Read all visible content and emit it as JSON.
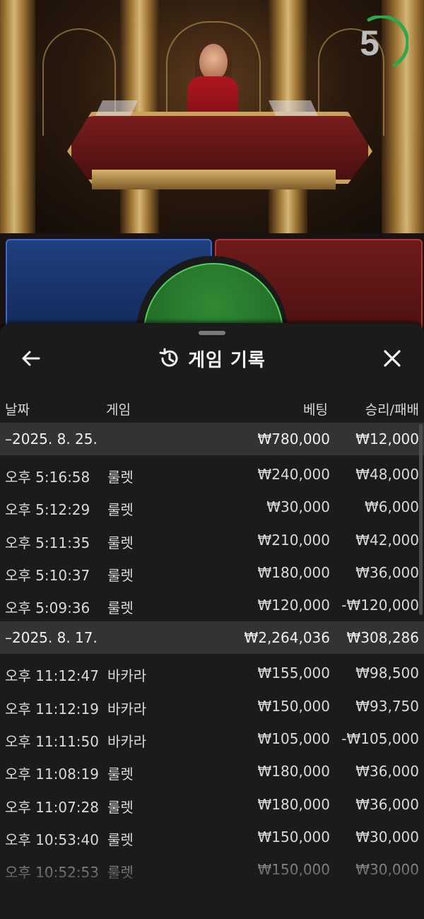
{
  "timer": {
    "value": "5",
    "color": "#2ea84a"
  },
  "panel": {
    "title": "게임 기록",
    "icons": {
      "back": "arrow-left-icon",
      "history": "history-clock-icon",
      "close": "close-icon"
    }
  },
  "columns": {
    "date": "날짜",
    "game": "게임",
    "bet": "베팅",
    "result": "승리/패배"
  },
  "groups": [
    {
      "date": "–2025. 8. 25.",
      "bet_total": "₩780,000",
      "result_total": "₩12,000",
      "rows": [
        {
          "time": "오후 5:16:58",
          "game": "룰렛",
          "bet": "₩240,000",
          "result": "₩48,000"
        },
        {
          "time": "오후 5:12:29",
          "game": "룰렛",
          "bet": "₩30,000",
          "result": "₩6,000"
        },
        {
          "time": "오후 5:11:35",
          "game": "룰렛",
          "bet": "₩210,000",
          "result": "₩42,000"
        },
        {
          "time": "오후 5:10:37",
          "game": "룰렛",
          "bet": "₩180,000",
          "result": "₩36,000"
        },
        {
          "time": "오후 5:09:36",
          "game": "룰렛",
          "bet": "₩120,000",
          "result": "-₩120,000"
        }
      ]
    },
    {
      "date": "–2025. 8. 17.",
      "bet_total": "₩2,264,036",
      "result_total": "₩308,286",
      "rows": [
        {
          "time": "오후 11:12:47",
          "game": "바카라",
          "bet": "₩155,000",
          "result": "₩98,500"
        },
        {
          "time": "오후 11:12:19",
          "game": "바카라",
          "bet": "₩150,000",
          "result": "₩93,750"
        },
        {
          "time": "오후 11:11:50",
          "game": "바카라",
          "bet": "₩105,000",
          "result": "-₩105,000"
        },
        {
          "time": "오후 11:08:19",
          "game": "룰렛",
          "bet": "₩180,000",
          "result": "₩36,000"
        },
        {
          "time": "오후 11:07:28",
          "game": "룰렛",
          "bet": "₩180,000",
          "result": "₩36,000"
        },
        {
          "time": "오후 10:53:40",
          "game": "룰렛",
          "bet": "₩150,000",
          "result": "₩30,000"
        },
        {
          "time": "오후 10:52:53",
          "game": "룰렛",
          "bet": "₩150,000",
          "result": "₩30,000"
        }
      ]
    }
  ]
}
